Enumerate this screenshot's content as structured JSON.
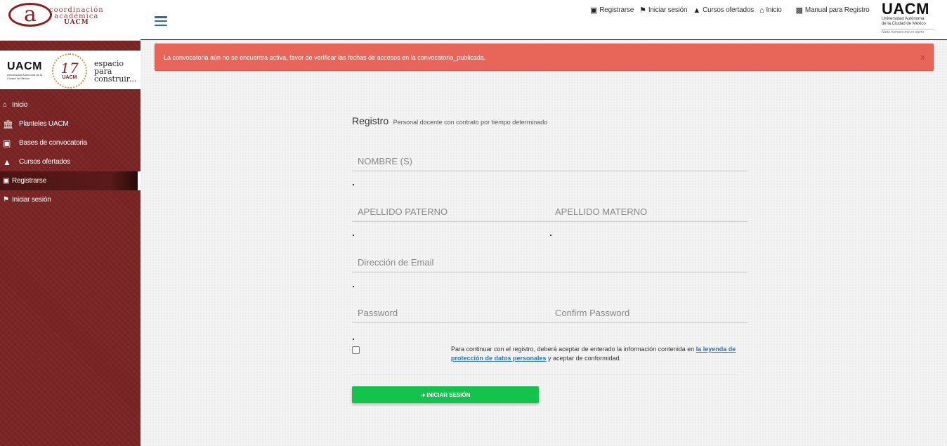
{
  "sidebar": {
    "logo": {
      "letter": "a",
      "line1": "coordinación",
      "line2": "académica",
      "line3": "UACM"
    },
    "banner": {
      "uacm": "UACM",
      "uacm_sub": "Universidad Autónoma de la Ciudad de México",
      "anniversary_number": "17",
      "anniversary_text": "UACM",
      "slogan_1": "espacio",
      "slogan_2": "para",
      "slogan_3": "construir..."
    },
    "items": [
      {
        "label": "Inicio",
        "icon": "home-icon"
      },
      {
        "label": "Planteles UACM",
        "icon": "institution-icon"
      },
      {
        "label": "Bases de convocatoria",
        "icon": "book-icon"
      },
      {
        "label": "Cursos ofertados",
        "icon": "graduation-cap-icon"
      },
      {
        "label": "Registrarse",
        "icon": "book-icon"
      },
      {
        "label": "Iniciar sesión",
        "icon": "flag-icon"
      }
    ]
  },
  "header": {
    "links": {
      "registrarse": "Registrarse",
      "iniciar_sesion": "Iniciar sesión",
      "cursos": "Cursos ofertados",
      "inicio": "Inicio",
      "manual": "Manual para Registro"
    },
    "logo": {
      "big": "UACM",
      "sub_1": "Universidad Autónoma",
      "sub_2": "de la Ciudad de México",
      "motto": "Nada humano me es ajeno"
    }
  },
  "alert": {
    "message": "La convocatoria aún no se encuentra activa, favor de verificar las fechas de accesos en la convocatoria_publicada.",
    "close": "x"
  },
  "form": {
    "title": "Registro",
    "subtitle": "Personal docente con contrato por tiempo determinado",
    "fields": {
      "nombre": {
        "placeholder": "NOMBRE (S)",
        "value": ""
      },
      "apellido_paterno": {
        "placeholder": "APELLIDO PATERNO",
        "value": ""
      },
      "apellido_materno": {
        "placeholder": "APELLIDO MATERNO",
        "value": ""
      },
      "email": {
        "placeholder": "Dirección de Email",
        "value": ""
      },
      "password": {
        "placeholder": "Password",
        "value": ""
      },
      "confirm_password": {
        "placeholder": "Confirm Password",
        "value": ""
      }
    },
    "consent": {
      "text_before": "Para continuar con el registro, deberá aceptar de enterado la información contenida en ",
      "link": "la leyenda de protección de datos personales",
      "text_after": " y aceptar de conformidad.",
      "checked": false
    },
    "submit_label": "INICIAR SESIÓN"
  },
  "colors": {
    "sidebar_bg": "#7a2424",
    "alert_bg": "#e8655a",
    "submit_bg": "#13c34c",
    "link": "#2a73b6"
  }
}
